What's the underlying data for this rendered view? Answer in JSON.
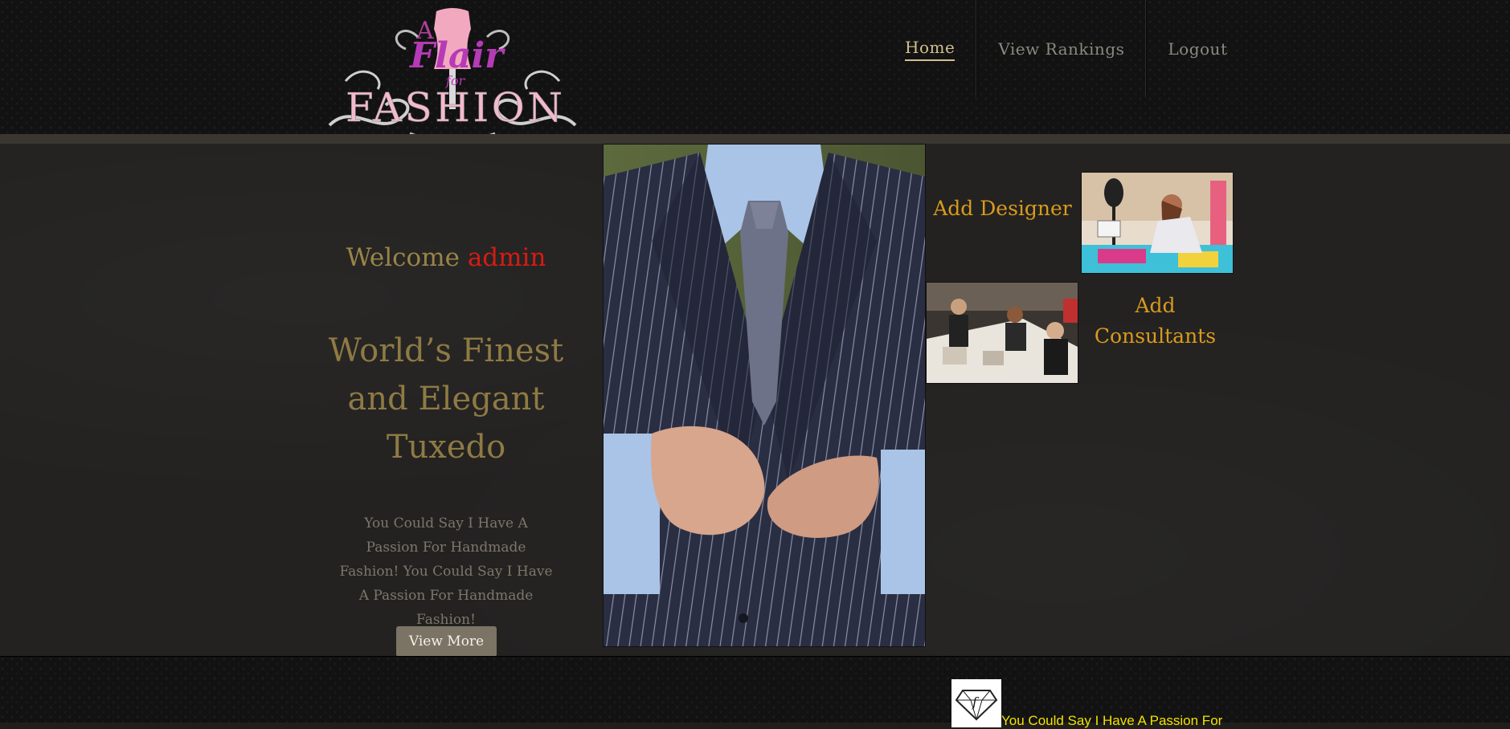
{
  "header": {
    "logo": {
      "line1": "A",
      "line2": "Flair",
      "line3": "for",
      "line4": "FASHION"
    },
    "nav": [
      {
        "label": "Home",
        "active": true
      },
      {
        "label": "View Rankings",
        "active": false
      },
      {
        "label": "Logout",
        "active": false
      }
    ]
  },
  "main": {
    "welcome_prefix": "Welcome",
    "username": "admin",
    "headline": "World’s Finest and Elegant Tuxedo",
    "blurb": "You Could Say I Have A Passion For Handmade Fashion! You Could Say I Have A Passion For Handmade Fashion!",
    "view_more_label": "View More",
    "add_designer_label": "Add Designer",
    "add_consultants_label": "Add Consultants"
  },
  "footer": {
    "text": "You Could Say I Have A Passion For"
  },
  "colors": {
    "accent_gold": "#d99b1c",
    "headline_gold": "#8f7a44",
    "username_red": "#d41c14",
    "footer_yellow": "#f2e200"
  }
}
